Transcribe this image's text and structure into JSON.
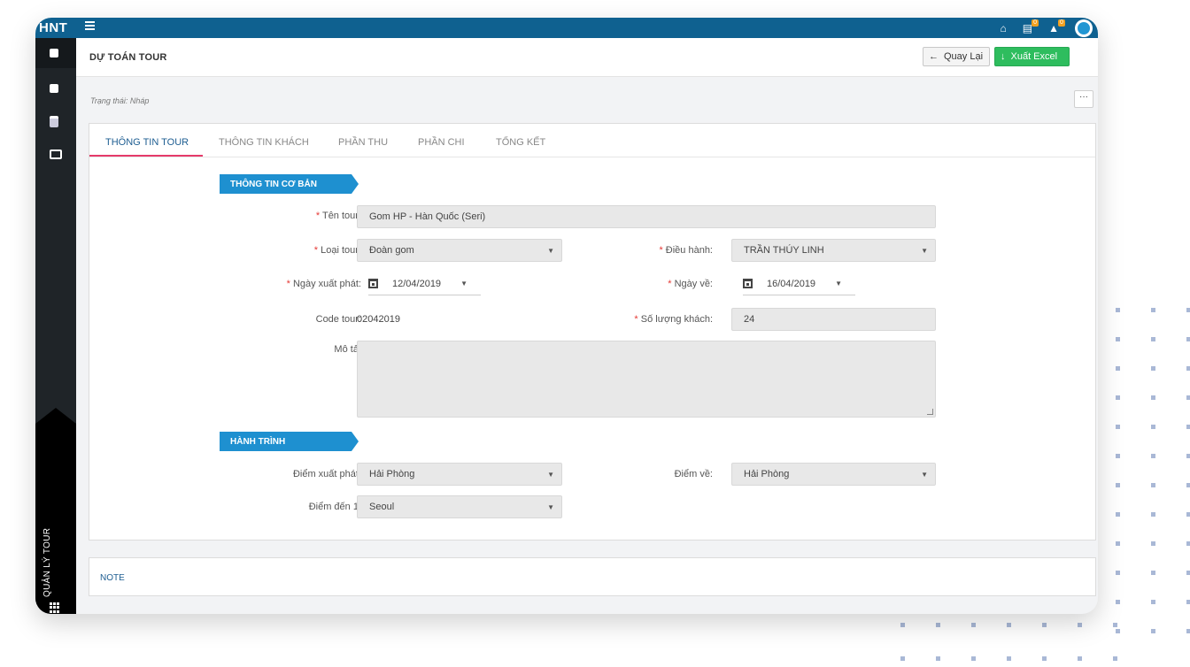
{
  "app": {
    "brand": "HNT",
    "notifications": {
      "calendar_count": "0",
      "bell_count": "0"
    }
  },
  "sidebar": {
    "items": [
      {
        "icon": "bus-icon"
      },
      {
        "icon": "briefcase-icon"
      },
      {
        "icon": "clipboard-icon"
      },
      {
        "icon": "card-icon"
      }
    ],
    "module_label": "QUẢN LÝ TOUR"
  },
  "header": {
    "title": "DỰ TOÁN TOUR",
    "back_label": "Quay Lại",
    "export_label": "Xuất Excel"
  },
  "status_text": "Trạng thái: Nháp",
  "more_label": "···",
  "tabs": [
    {
      "label": "THÔNG TIN TOUR",
      "active": true
    },
    {
      "label": "THÔNG TIN KHÁCH"
    },
    {
      "label": "PHẦN THU"
    },
    {
      "label": "PHẦN CHI"
    },
    {
      "label": "TỔNG KẾT"
    }
  ],
  "basic_info": {
    "section_title": "THÔNG TIN CƠ BẢN",
    "tour_name_label": "Tên tour:",
    "tour_name_value": "Gom HP - Hàn Quốc (Seri)",
    "tour_type_label": "Loại tour:",
    "tour_type_value": "Đoàn gom",
    "operator_label": "Điều hành:",
    "operator_value": "TRẦN THÚY LINH",
    "departure_date_label": "Ngày xuất phát:",
    "departure_date_value": "12/04/2019",
    "return_date_label": "Ngày về:",
    "return_date_value": "16/04/2019",
    "code_label": "Code tour:",
    "code_value": "02042019",
    "guest_count_label": "Số lượng khách:",
    "guest_count_value": "24",
    "description_label": "Mô tả:",
    "required_mark": "*"
  },
  "itinerary": {
    "section_title": "HÀNH TRÌNH",
    "start_label": "Điểm xuất phát:",
    "start_value": "Hải Phòng",
    "end_label": "Điểm về:",
    "end_value": "Hải Phòng",
    "dest1_label": "Điểm đến 1:",
    "dest1_value": "Seoul"
  },
  "note": {
    "title": "NOTE"
  },
  "colors": {
    "topbar": "#0f6190",
    "accent": "#1e90d0",
    "tab_active_underline": "#e53b6a",
    "export_button": "#2ebd5e",
    "required": "#e53935"
  }
}
